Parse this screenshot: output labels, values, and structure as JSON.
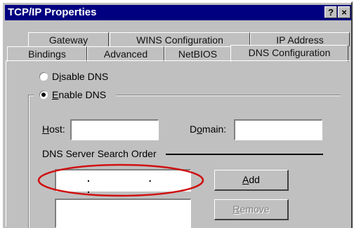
{
  "window": {
    "title": "TCP/IP Properties",
    "help_label": "?",
    "close_label": "×"
  },
  "tabs_back": [
    "Gateway",
    "WINS Configuration",
    "IP Address"
  ],
  "tabs_front": [
    "Bindings",
    "Advanced",
    "NetBIOS",
    "DNS Configuration"
  ],
  "dns": {
    "disable_label_pre": "D",
    "disable_label_ul": "i",
    "disable_label_post": "sable DNS",
    "enable_label_pre": "",
    "enable_label_ul": "E",
    "enable_label_post": "nable DNS",
    "host_label_ul": "H",
    "host_label_post": "ost:",
    "domain_label_pre": "D",
    "domain_label_ul": "o",
    "domain_label_post": "main:",
    "search_order_label": "DNS Server Search Order",
    "ip_dots": ". . .",
    "add_label_ul": "A",
    "add_label_post": "dd",
    "remove_label_ul": "R",
    "remove_label_post": "emove",
    "selected": "enable"
  },
  "colors": {
    "titlebar": "#000080",
    "annotation_oval": "#d01010"
  }
}
